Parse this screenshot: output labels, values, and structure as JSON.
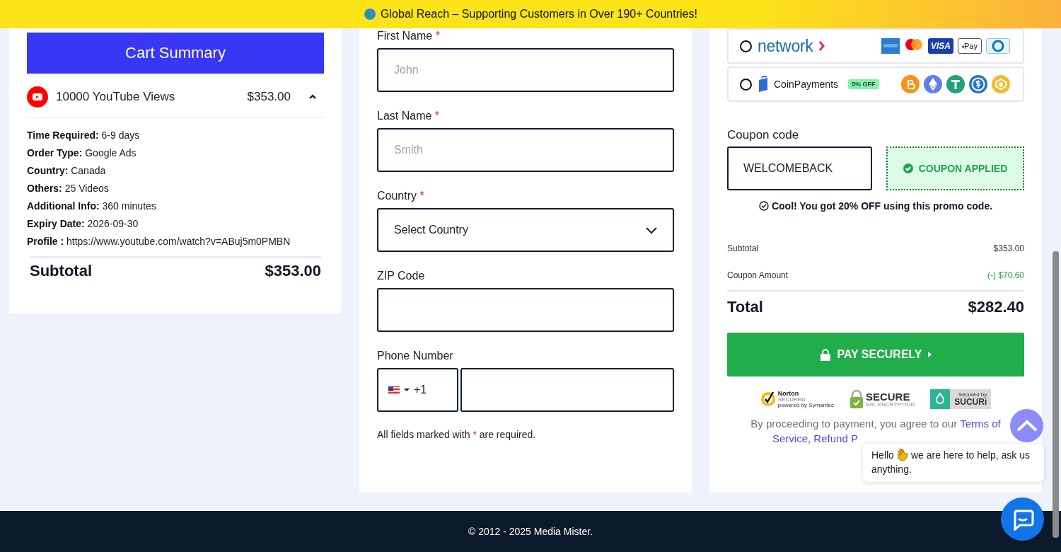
{
  "banner": {
    "text": "Global Reach – Supporting Customers in Over 190+ Countries!"
  },
  "cart": {
    "title": "Cart Summary",
    "item": {
      "name": "10000 YouTube Views",
      "price": "$353.00",
      "expanded": true
    },
    "details": [
      {
        "label": "Time Required:",
        "value": "6-9 days"
      },
      {
        "label": "Order Type:",
        "value": "Google Ads"
      },
      {
        "label": "Country:",
        "value": "Canada"
      },
      {
        "label": "Others:",
        "value": "25 Videos"
      },
      {
        "label": "Additional Info:",
        "value": "360 minutes"
      },
      {
        "label": "Expiry Date:",
        "value": "2026-09-30"
      },
      {
        "label": "Profile :",
        "value": "https://www.youtube.com/watch?v=ABuj5m0PMBN"
      }
    ],
    "subtotal": {
      "label": "Subtotal",
      "value": "$353.00"
    }
  },
  "form": {
    "fields": [
      {
        "kind": "text",
        "label": "First Name",
        "required_mark": "*",
        "placeholder": "John"
      },
      {
        "kind": "text",
        "label": "Last Name",
        "required_mark": "*",
        "placeholder": "Smith"
      },
      {
        "kind": "select",
        "label": "Country",
        "required_mark": "*",
        "value": "Select Country"
      },
      {
        "kind": "text",
        "label": "ZIP Code"
      },
      {
        "kind": "phone",
        "label": "Phone Number",
        "code": "+1"
      }
    ],
    "note": {
      "before": "All fields marked with",
      "mark": "*",
      "after": "are required."
    }
  },
  "payment": {
    "methods": [
      {
        "kind": "network",
        "name": "network",
        "selected": false,
        "logos": [
          {
            "kind": "amex"
          },
          {
            "kind": "mastercard"
          },
          {
            "kind": "visa",
            "text": "VISA"
          },
          {
            "kind": "applepay",
            "text": "Pay"
          },
          {
            "kind": "diners"
          }
        ]
      },
      {
        "kind": "coinpayments",
        "name": "CoinPayments",
        "badge": "5% OFF",
        "selected": false,
        "logos": [
          {
            "kind": "bitcoin"
          },
          {
            "kind": "ethereum"
          },
          {
            "kind": "tether"
          },
          {
            "kind": "usdc"
          },
          {
            "kind": "bnb"
          }
        ]
      }
    ],
    "coupon": {
      "label": "Coupon code",
      "value": "WELCOMEBACK",
      "status": "COUPON APPLIED",
      "applied": true,
      "message": "Cool! You got 20% OFF using this promo code."
    },
    "summary": [
      {
        "kind": "plain",
        "label": "Subtotal",
        "value": "$353.00"
      },
      {
        "kind": "discount",
        "label": "Coupon Amount",
        "value": "(-) $70.60"
      }
    ],
    "total": {
      "label": "Total",
      "value": "$282.40"
    },
    "pay_button": "PAY SECURELY",
    "badges": [
      {
        "kind": "norton",
        "lines": [
          "Norton",
          "SECURED",
          "powered by Symantec"
        ]
      },
      {
        "kind": "ssl",
        "lines": [
          "SECURE",
          "SSL ENCRYPTION"
        ]
      },
      {
        "kind": "sucuri",
        "lines": [
          "Secured by",
          "SUCURi"
        ]
      }
    ],
    "legal": {
      "text": "By proceeding to payment, you agree to our",
      "links": [
        "Terms of",
        "Service, Refund P"
      ]
    }
  },
  "chat": {
    "before": "Hello",
    "after": "we are here to help, ask us anything."
  },
  "footer": {
    "text": "© 2012 - 2025 Media Mister."
  }
}
